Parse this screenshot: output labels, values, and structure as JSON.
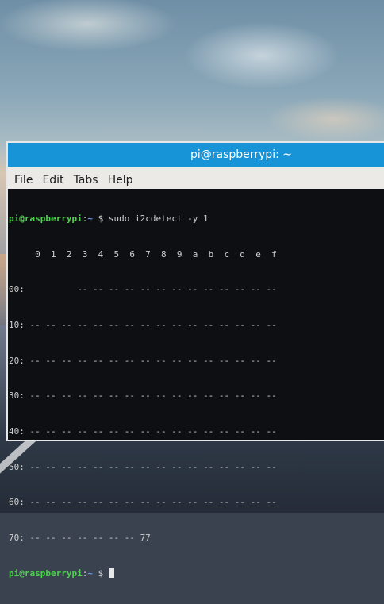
{
  "window": {
    "title": "pi@raspberrypi: ~"
  },
  "menu": {
    "file": "File",
    "edit": "Edit",
    "tabs": "Tabs",
    "help": "Help"
  },
  "terminal": {
    "prompt_user": "pi@raspberrypi",
    "prompt_sep": ":",
    "prompt_path": "~",
    "prompt_symbol": " $ ",
    "command": "sudo i2cdetect -y 1",
    "output_lines": [
      "     0  1  2  3  4  5  6  7  8  9  a  b  c  d  e  f",
      "00:          -- -- -- -- -- -- -- -- -- -- -- -- --",
      "10: -- -- -- -- -- -- -- -- -- -- -- -- -- -- -- --",
      "20: -- -- -- -- -- -- -- -- -- -- -- -- -- -- -- --",
      "30: -- -- -- -- -- -- -- -- -- -- -- -- -- -- -- --",
      "40: -- -- -- -- -- -- -- -- -- -- -- -- -- -- -- --",
      "50: -- -- -- -- -- -- -- -- -- -- -- -- -- -- -- --",
      "60: -- -- -- -- -- -- -- -- -- -- -- -- -- -- -- --",
      "70: -- -- -- -- -- -- -- 77"
    ]
  },
  "colors": {
    "titlebar": "#1793d8",
    "prompt_user": "#4fd24f",
    "prompt_path": "#6a9ae8",
    "terminal_bg": "#0d0f12"
  }
}
